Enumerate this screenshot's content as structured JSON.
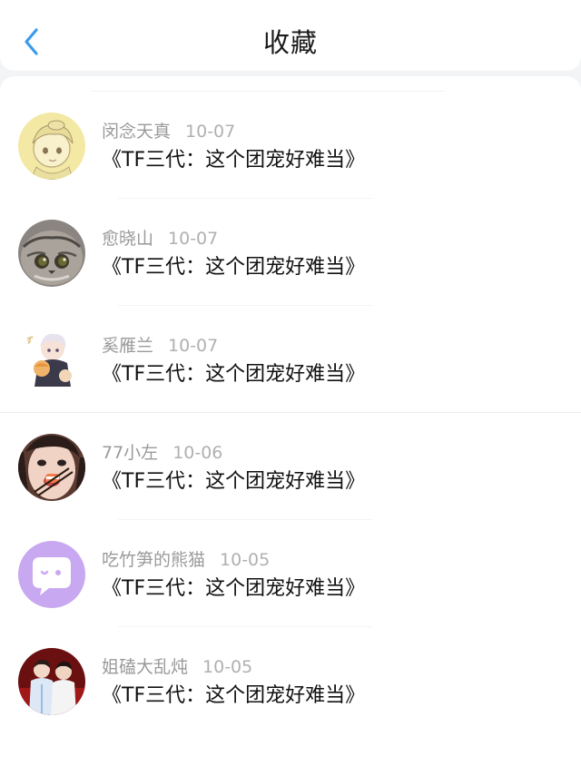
{
  "header": {
    "title": "收藏",
    "back_icon": "chevron-left-icon",
    "accent_color": "#3b9bf0"
  },
  "favorites": [
    {
      "user": "闵念天真",
      "date": "10-07",
      "book": "《TF三代：这个团宠好难当》",
      "avatar": "anime-girl-sketch"
    },
    {
      "user": "愈晓山",
      "date": "10-07",
      "book": "《TF三代：这个团宠好难当》",
      "avatar": "cat-photo"
    },
    {
      "user": "奚雁兰",
      "date": "10-07",
      "book": "《TF三代：这个团宠好难当》",
      "avatar": "anime-chibi"
    },
    {
      "user": "77小左",
      "date": "10-06",
      "book": "《TF三代：这个团宠好难当》",
      "avatar": "girl-eating-sushi"
    },
    {
      "user": "吃竹笋的熊猫",
      "date": "10-05",
      "book": "《TF三代：这个团宠好难当》",
      "avatar": "purple-chat-bubble"
    },
    {
      "user": "姐磕大乱炖",
      "date": "10-05",
      "book": "《TF三代：这个团宠好难当》",
      "avatar": "two-people-stage"
    }
  ]
}
